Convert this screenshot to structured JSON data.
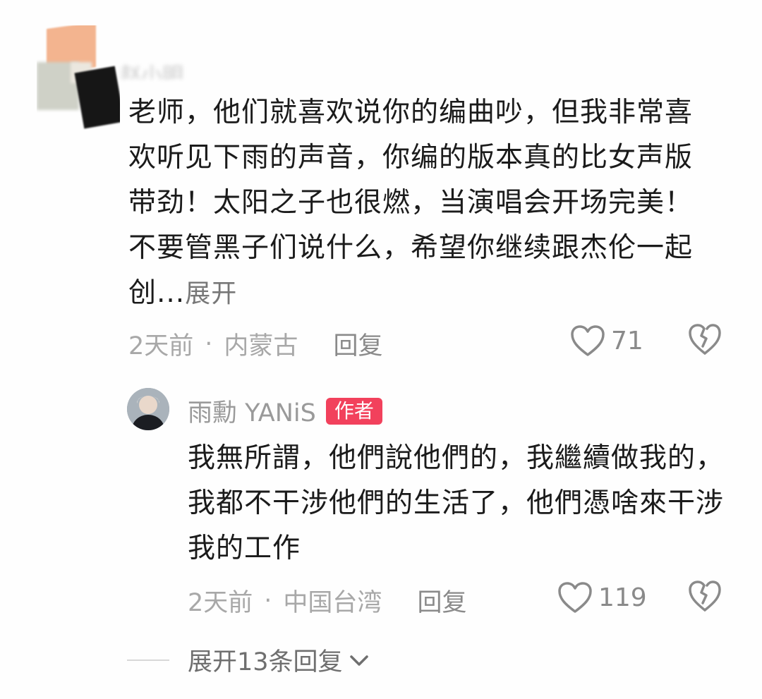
{
  "comment": {
    "username": "赵小明",
    "text": "老师，他们就喜欢说你的编曲吵，但我非常喜欢听见下雨的声音，你编的版本真的比女声版带劲！太阳之子也很燃，当演唱会开场完美！不要管黑子们说什么，希望你继续跟杰伦一起创...",
    "expand_label": "展开",
    "time": "2天前",
    "location": "内蒙古",
    "reply_label": "回复",
    "like_count": "71"
  },
  "reply": {
    "username": "雨勳 YANiS",
    "badge": "作者",
    "text": "我無所謂，他們說他們的，我繼續做我的，我都不干涉他們的生活了，他們憑啥來干涉我的工作",
    "time": "2天前",
    "location": "中国台湾",
    "reply_label": "回复",
    "like_count": "119"
  },
  "more_replies_label": "展开13条回复",
  "separator": "·",
  "icons": {
    "like": "heart-outline-icon",
    "dislike": "broken-heart-icon",
    "expand": "chevron-down-icon"
  },
  "colors": {
    "badge": "#f2415c",
    "meta": "#a8a8a8"
  }
}
